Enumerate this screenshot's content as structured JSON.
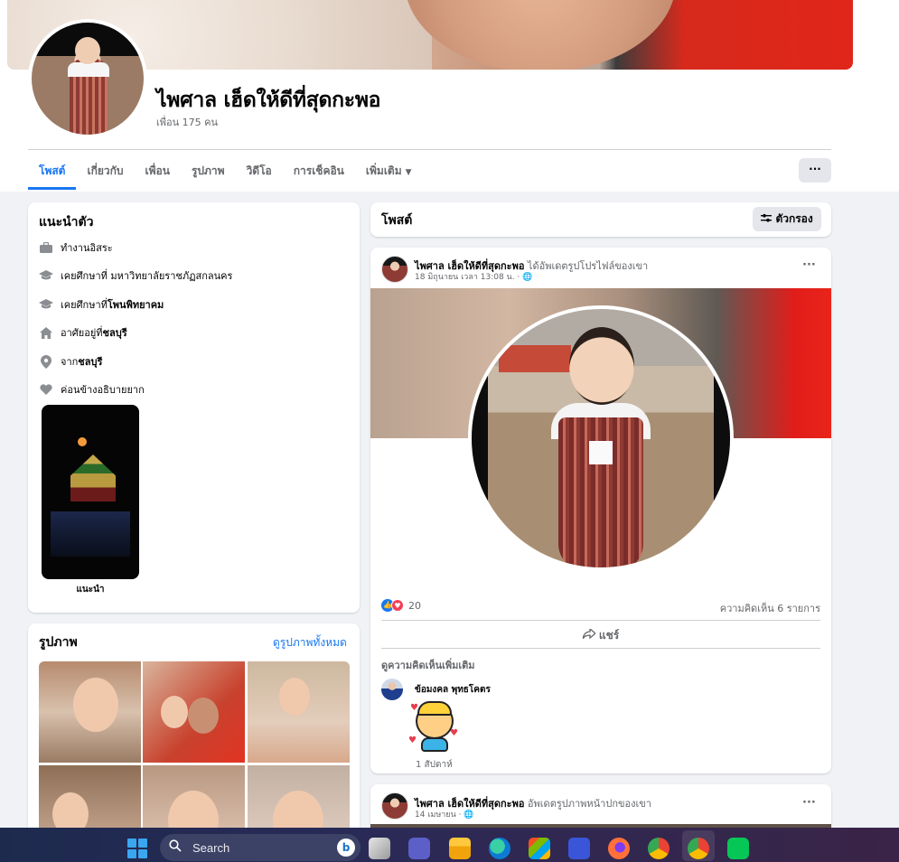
{
  "profile": {
    "name": "ไพศาล เฮ็ดให้ดีที่สุดกะพอ",
    "friends": "เพื่อน 175 คน"
  },
  "tabs": [
    {
      "label": "โพสต์",
      "active": true
    },
    {
      "label": "เกี่ยวกับ",
      "active": false
    },
    {
      "label": "เพื่อน",
      "active": false
    },
    {
      "label": "รูปภาพ",
      "active": false
    },
    {
      "label": "วิดีโอ",
      "active": false
    },
    {
      "label": "การเช็คอิน",
      "active": false
    },
    {
      "label": "เพิ่มเติม",
      "active": false
    }
  ],
  "more_button": "···",
  "intro": {
    "title": "แนะนำตัว",
    "items": [
      {
        "icon": "briefcase-icon",
        "text": "ทำงานอิสระ",
        "bold": ""
      },
      {
        "icon": "graduation-cap-icon",
        "text": "เคยศึกษาที่ มหาวิทยาลัยราชภัฏสกลนคร",
        "bold": ""
      },
      {
        "icon": "graduation-cap-icon",
        "text": "เคยศึกษาที่ ",
        "bold": "โพนพิทยาคม"
      },
      {
        "icon": "home-icon",
        "text": "อาศัยอยู่ที่ ",
        "bold": "ชลบุรี"
      },
      {
        "icon": "location-pin-icon",
        "text": "จาก ",
        "bold": "ชลบุรี"
      },
      {
        "icon": "heart-icon",
        "text": "ค่อนข้างอธิบายยาก",
        "bold": ""
      }
    ],
    "featured_label": "แนะนำ"
  },
  "photos": {
    "title": "รูปภาพ",
    "see_all": "ดูรูปภาพทั้งหมด"
  },
  "posts_section": {
    "title": "โพสต์",
    "filter_label": "ตัวกรอง"
  },
  "post1": {
    "author": "ไพศาล เฮ็ดให้ดีที่สุดกะพอ",
    "action": " ได้อัพเดตรูปโปรไฟล์ของเขา",
    "meta": "18 มิถุนายน เวลา 13:08 น. · ",
    "reaction_count": "20",
    "comment_count": "ความคิดเห็น 6 รายการ",
    "share_label": "แชร์",
    "more_comments": "ดูความคิดเห็นเพิ่มเติม",
    "commenter": "ข้อมงคล พุทธโคตร",
    "comment_time": "1 สัปดาห์"
  },
  "post2": {
    "author": "ไพศาล เฮ็ดให้ดีที่สุดกะพอ",
    "action": " อัพเดตรูปภาพหน้าปกของเขา",
    "meta": "14 เมษายน · "
  },
  "taskbar": {
    "search_label": "Search",
    "apps": [
      "task-view-icon",
      "meet-icon",
      "file-explorer-icon",
      "edge-icon",
      "store-icon",
      "app-icon",
      "firefox-icon",
      "chrome-icon",
      "chrome-profile-icon",
      "line-icon"
    ]
  },
  "colors": {
    "accent": "#1877f2",
    "background": "#f0f2f5",
    "like": "#1877f2",
    "love": "#f33e58",
    "line_green": "#06c755"
  }
}
